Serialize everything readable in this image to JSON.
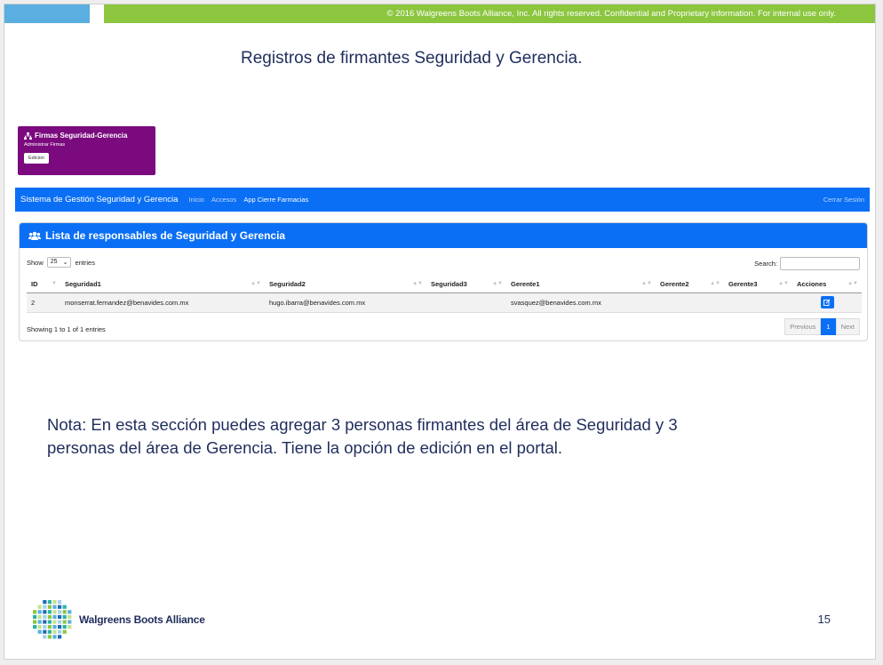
{
  "footer_notice": "© 2016 Walgreens Boots Alliance, Inc. All rights reserved. Confidential and Proprietary information. For internal use only.",
  "slide_title": "Registros de firmantes Seguridad y Gerencia.",
  "firma_card": {
    "title": "Firmas Seguridad-Gerencia",
    "subtitle": "Administrar Firmas",
    "button": "Edicion",
    "color": "#7a0a7e",
    "icon": "sitemap-icon"
  },
  "app_nav": {
    "brand": "Sistema de Gestión Seguridad y Gerencia",
    "links": [
      "Inicio",
      "Accesos",
      "App Cierre Farmacias"
    ],
    "logout": "Cerrar Sesión",
    "color": "#0a6ff5"
  },
  "card": {
    "title": "Lista de responsables de Seguridad y Gerencia",
    "icon": "users-icon",
    "length_prefix": "Show",
    "length_value": "25",
    "length_suffix": "entries",
    "search_label": "Search:",
    "columns": [
      "ID",
      "Seguridad1",
      "Seguridad2",
      "Seguridad3",
      "Gerente1",
      "Gerente2",
      "Gerente3",
      "Acciones"
    ],
    "rows": [
      [
        "2",
        "monserrat.fernandez@benavides.com.mx",
        "hugo.ibarra@benavides.com.mx",
        "",
        "svasquez@benavides.com.mx",
        "",
        ""
      ]
    ],
    "action_icon": "edit-icon",
    "info": "Showing 1 to 1 of 1 entries",
    "pager": {
      "previous": "Previous",
      "page": "1",
      "next": "Next"
    }
  },
  "nota": "Nota: En esta sección puedes agregar 3 personas firmantes del área de Seguridad y 3 personas del área de Gerencia. Tiene la opción de edición en el portal.",
  "logo_text": "Walgreens Boots Alliance",
  "page_number": "15"
}
